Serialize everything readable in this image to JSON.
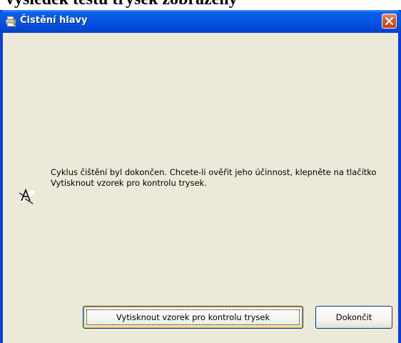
{
  "background_text": "výsledek testu trysek zobrazený",
  "window": {
    "title": "Čistění hlavy",
    "title_icon": "printer-icon",
    "close_icon": "close-icon"
  },
  "content": {
    "message_icon": "printhead-cleaning-icon",
    "message": "Cyklus čištění byl dokončen. Chcete-li ověřit jeho účinnost, klepněte na tlačítko Vytisknout vzorek pro kontrolu trysek."
  },
  "buttons": {
    "print_label": "Vytisknout vzorek pro kontrolu trysek",
    "finish_label": "Dokončit"
  },
  "colors": {
    "titlebar": "#0554e3",
    "dialog_background": "#ece9d8",
    "close_button": "#d9532e",
    "focus_highlight": "#f8b636"
  }
}
